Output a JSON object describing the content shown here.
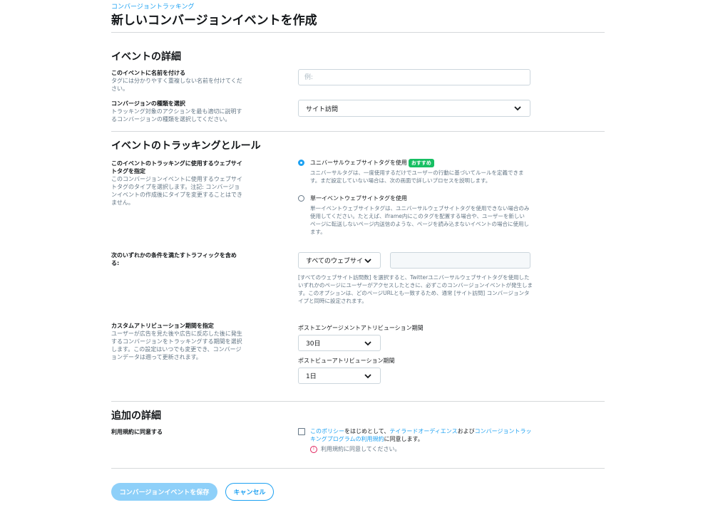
{
  "header": {
    "breadcrumb": "コンバージョントラッキング",
    "title": "新しいコンバージョンイベントを作成"
  },
  "event_details": {
    "section_title": "イベントの詳細",
    "name_label": "このイベントに名前を付ける",
    "name_help": "タグには分かりやすく重複しない名前を付けてください。",
    "name_placeholder": "例:",
    "type_label": "コンバージョンの種類を選択",
    "type_help": "トラッキング対象のアクションを最も適切に説明するコンバージョンの種類を選択してください。",
    "type_value": "サイト訪問"
  },
  "tracking": {
    "section_title": "イベントのトラッキングとルール",
    "tag_label": "このイベントのトラッキングに使用するウェブサイトタグを指定",
    "tag_help": "このコンバージョンイベントに使用するウェブサイトタグのタイプを選択します。注記: コンバージョンイベントの作成後にタイプを変更することはできません。",
    "option1_title": "ユニバーサルウェブサイトタグを使用",
    "option1_badge": "おすすめ",
    "option1_desc": "ユニバーサルタグは、一度使用するだけでユーザーの行動に基づいてルールを定義できます。まだ設定していない場合は、次の画面で詳しいプロセスを説明します。",
    "option2_title": "単一イベントウェブサイトタグを使用",
    "option2_desc": "単一イベントウェブサイトタグは、ユニバーサルウェブサイトタグを使用できない場合のみ使用してください。たとえば、iframe内にこのタグを配置する場合や、ユーザーを新しいページに転送しないページ内送信のような、ページを読み込まないイベントの場合に使用します。",
    "traffic_label": "次のいずれかの条件を満たすトラフィックを含める:",
    "traffic_value": "すべてのウェブサイ",
    "traffic_note": "[すべてのウェブサイト訪問数] を選択すると、Twitterユニバーサルウェブサイトタグを使用したいずれかのページにユーザーがアクセスしたときに、必ずこのコンバージョンイベントが発生します。このオプションは、どのページURLとも一致するため、通常 [サイト訪問] コンバージョンタイプと同時に設定されます。",
    "attribution_label": "カスタムアトリビューション期間を指定",
    "attribution_help": "ユーザーが広告を見た後や広告に反応した後に発生するコンバージョンをトラッキングする期間を選択します。この設定はいつでも変更でき、コンバージョンデータは遡って更新されます。",
    "engagement_label": "ポストエンゲージメントアトリビューション期間",
    "engagement_value": "30日",
    "view_label": "ポストビューアトリビューション期間",
    "view_value": "1日"
  },
  "additional": {
    "section_title": "追加の詳細",
    "terms_label": "利用規約に同意する",
    "terms_link1": "このポリシー",
    "terms_text1": "をはじめとして、",
    "terms_link2": "テイラードオーディエンス",
    "terms_text2": "および",
    "terms_link3": "コンバージョントラッキングプログラムの利用規約",
    "terms_text3": "に同意します。",
    "error_text": "利用規約に同意してください。"
  },
  "footer": {
    "save_label": "コンバージョンイベントを保存",
    "cancel_label": "キャンセル"
  },
  "colors": {
    "accent": "#1da1f2",
    "badge": "#17bf63",
    "error": "#e0245e"
  }
}
